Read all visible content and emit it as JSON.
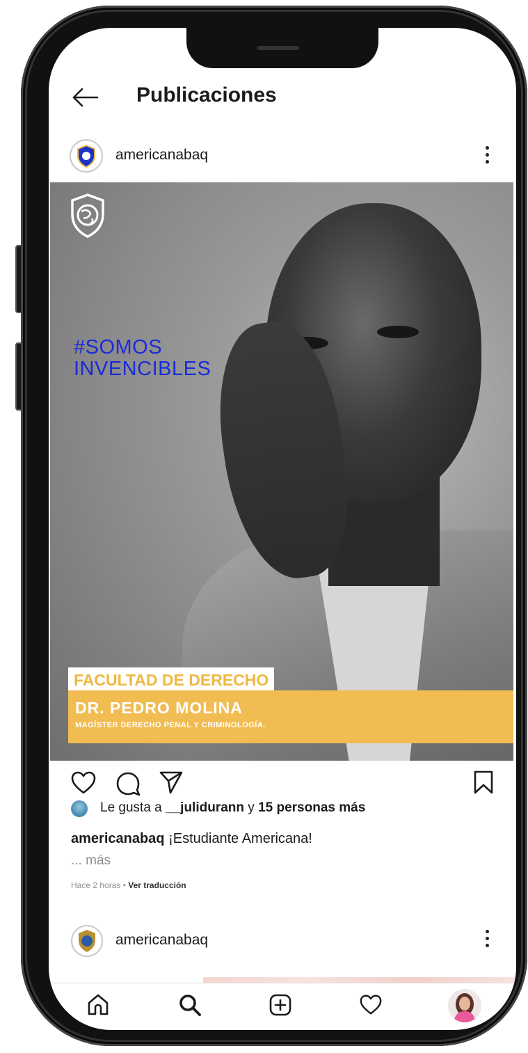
{
  "header": {
    "title": "Publicaciones"
  },
  "post": {
    "username": "americanabaq",
    "image": {
      "hashtag_line1": "#SOMOS",
      "hashtag_line2": "INVENCIBLES",
      "faculty": "FACULTAD DE DERECHO",
      "person_name": "DR. PEDRO MOLINA",
      "person_title": "MAGÍSTER DERECHO PENAL Y CRIMINOLOGÍA."
    },
    "likes": {
      "prefix": "Le gusta a ",
      "user": "__julidurann",
      "middle": " y ",
      "others": "15 personas más"
    },
    "caption": {
      "user": "americanabaq",
      "text": " ¡Estudiante Americana!"
    },
    "more": "... más",
    "time": "Hace 2 horas",
    "separator": " • ",
    "translate": "Ver traducción"
  },
  "next_post": {
    "username": "americanabaq"
  },
  "colors": {
    "accent_yellow": "#f1bc52",
    "hashtag_blue": "#1a2bd8"
  },
  "icons": [
    "back-arrow-icon",
    "more-options-icon",
    "heart-icon",
    "comment-icon",
    "share-icon",
    "bookmark-icon",
    "home-icon",
    "search-icon",
    "add-post-icon",
    "activity-heart-icon",
    "profile-avatar"
  ]
}
